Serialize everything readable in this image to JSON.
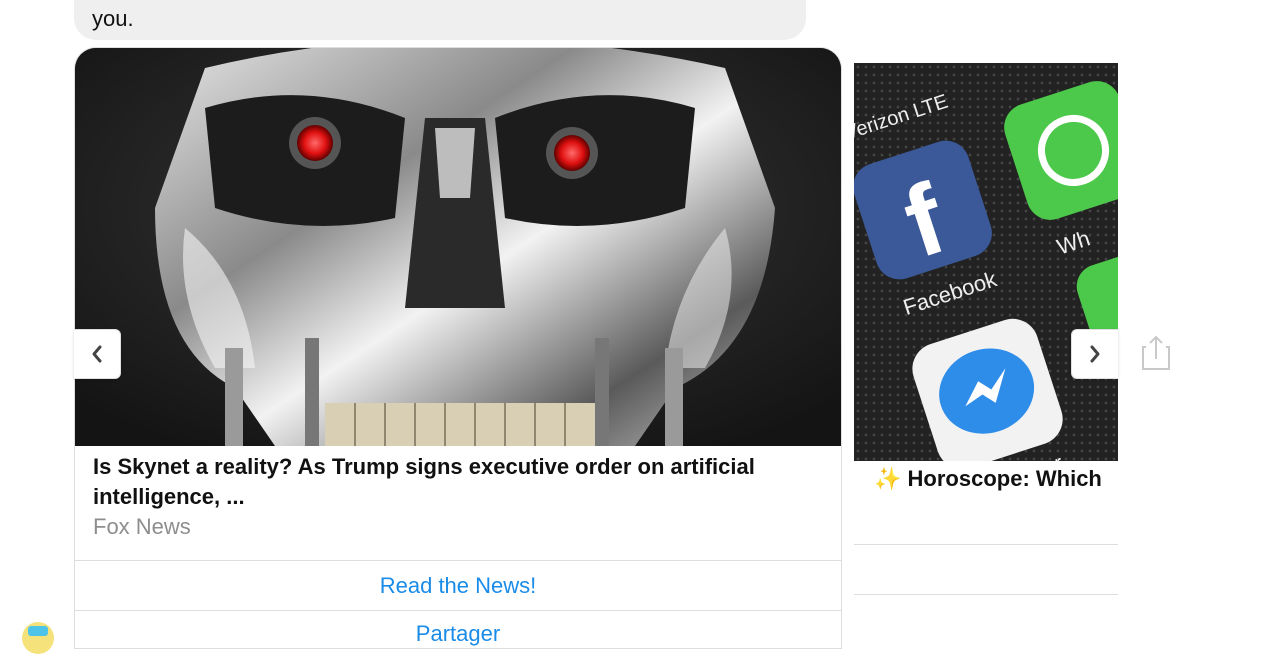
{
  "message": {
    "text_tail": "you."
  },
  "card1": {
    "title": "Is Skynet a reality? As Trump signs executive order on artificial intelligence, ...",
    "source": "Fox News",
    "button_read": "Read the News!",
    "button_share": "Partager"
  },
  "card2": {
    "title_emoji": "✨",
    "title": "Horoscope: Which",
    "image_texts": {
      "carrier": "oo Verizon  LTE",
      "facebook": "Facebook",
      "messenger": "Messenger",
      "whatsapp": "Wh"
    }
  },
  "controls": {
    "prev_icon": "chevron-left-icon",
    "next_icon": "chevron-right-icon",
    "share_icon": "share-icon"
  },
  "colors": {
    "link": "#1a8ce8",
    "bubble": "#efefef",
    "border": "#dedede"
  }
}
